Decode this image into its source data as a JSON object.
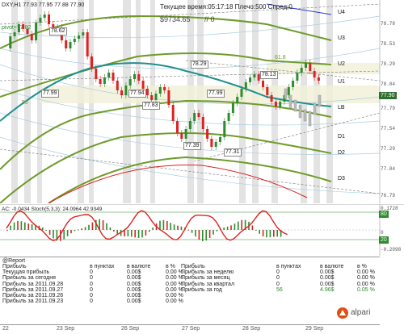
{
  "chart": {
    "symbol_line": "DXY,H1  77.93 77.95 77.88 77.90",
    "timer_text": "Текущее время:05:17:18 Плечо:500 Спред:0",
    "balance": "$9734.65",
    "balance_suffix": "// 0",
    "side_note": "pivot=77.82",
    "fib_label": "61.8",
    "fib_label_left": "50",
    "current_price": "77.90",
    "price_labels": [
      {
        "text": "78.62"
      },
      {
        "text": "78.29"
      },
      {
        "text": "78.13"
      },
      {
        "text": "77.99"
      },
      {
        "text": "77.94"
      },
      {
        "text": "77.99"
      },
      {
        "text": "77.83"
      },
      {
        "text": "77.39"
      },
      {
        "text": "77.31"
      }
    ],
    "band_labels": [
      "U4",
      "U3",
      "U2",
      "U1",
      "LB",
      "D1",
      "D2",
      "D3"
    ],
    "right_axis": [
      "78.78",
      "78.53",
      "78.29",
      "78.04",
      "77.79",
      "77.54",
      "77.29",
      "77.04",
      "76.79"
    ]
  },
  "indicator": {
    "label": "AC: -0.0434  Stoch(5,3,3): 24.0964 42.9349",
    "right_axis": [
      "0.1728",
      "80",
      "20",
      "0",
      "-0.2098"
    ]
  },
  "report": {
    "title": "@Report",
    "headers_left": [
      "Прибыль",
      "в пунктах",
      "в валюте",
      "в %"
    ],
    "rows_left": [
      [
        "Текущая прибыль",
        "0",
        "0.00$",
        "0.00 %"
      ],
      [
        "Прибыль за сегодня",
        "0",
        "0.00$",
        "0.00 %"
      ],
      [
        "Прибыль за 2011.09.28",
        "0",
        "0.00$",
        "0.00 %"
      ],
      [
        "Прибыль за 2011.09.27",
        "0",
        "0.00$",
        "0.00 %"
      ],
      [
        "Прибыль за 2011.09.26",
        "0",
        "0.00$",
        "0.00 %"
      ],
      [
        "Прибыль за 2011.09.23",
        "0",
        "0.00$",
        "0.00 %"
      ]
    ],
    "headers_right": [
      "Прибыль",
      "в пунктах",
      "в валюте",
      "в %"
    ],
    "rows_right": [
      [
        "Прибыль за неделю",
        "0",
        "0.00$",
        "0.00 %"
      ],
      [
        "Прибыль за месяц",
        "0",
        "0.00$",
        "0.00 %"
      ],
      [
        "Прибыль за квартал",
        "0",
        "0.00$",
        "0.00 %"
      ],
      [
        "Прибыль за год",
        "56",
        "4.96$",
        "0.05 %"
      ]
    ],
    "brand": "alpari"
  },
  "time_axis": [
    "22",
    "23 Sep",
    "26 Sep",
    "27 Sep",
    "28 Sep",
    "29 Sep"
  ],
  "colors": {
    "band": "#6f9a2a",
    "band_dark": "#4a7a1a",
    "pivot": "#1f8f8f",
    "red_ma": "#d22",
    "bull": "#2e8b2e",
    "bear": "#d22",
    "shade": "#f2f2e0"
  }
}
